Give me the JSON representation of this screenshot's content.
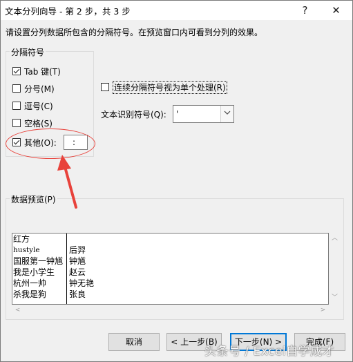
{
  "window": {
    "title": "文本分列向导 - 第 2 步，共 3 步",
    "help_icon": "?",
    "close_icon": "✕"
  },
  "instruction": "请设置分列数据所包含的分隔符号。在预览窗口内可看到分列的效果。",
  "delimiters": {
    "legend": "分隔符号",
    "tab": {
      "label": "Tab 键(T)",
      "checked": true
    },
    "semicolon": {
      "label": "分号(M)",
      "checked": false
    },
    "comma": {
      "label": "逗号(C)",
      "checked": false
    },
    "space": {
      "label": "空格(S)",
      "checked": false
    },
    "other": {
      "label": "其他(O):",
      "checked": true,
      "value": ":"
    }
  },
  "consecutive": {
    "label": "连续分隔符号视为单个处理(R)",
    "checked": false
  },
  "text_qualifier": {
    "label": "文本识别符号(Q):",
    "value": "'"
  },
  "preview": {
    "legend": "数据预览(P)",
    "col1": [
      "红方",
      "hustyle",
      "国服第一钟馗",
      "我是小学生",
      "杭州一帅",
      "杀我是狗"
    ],
    "col2": [
      "",
      "后羿",
      "钟馗",
      "赵云",
      "钟无艳",
      "张良"
    ]
  },
  "buttons": {
    "cancel": "取消",
    "back": "< 上一步(B)",
    "next": "下一步(N) >",
    "finish": "完成(F)"
  },
  "watermark": "头条号 / Excel自学成才",
  "colors": {
    "accent": "#0078d7",
    "annotation": "#e8423b"
  }
}
